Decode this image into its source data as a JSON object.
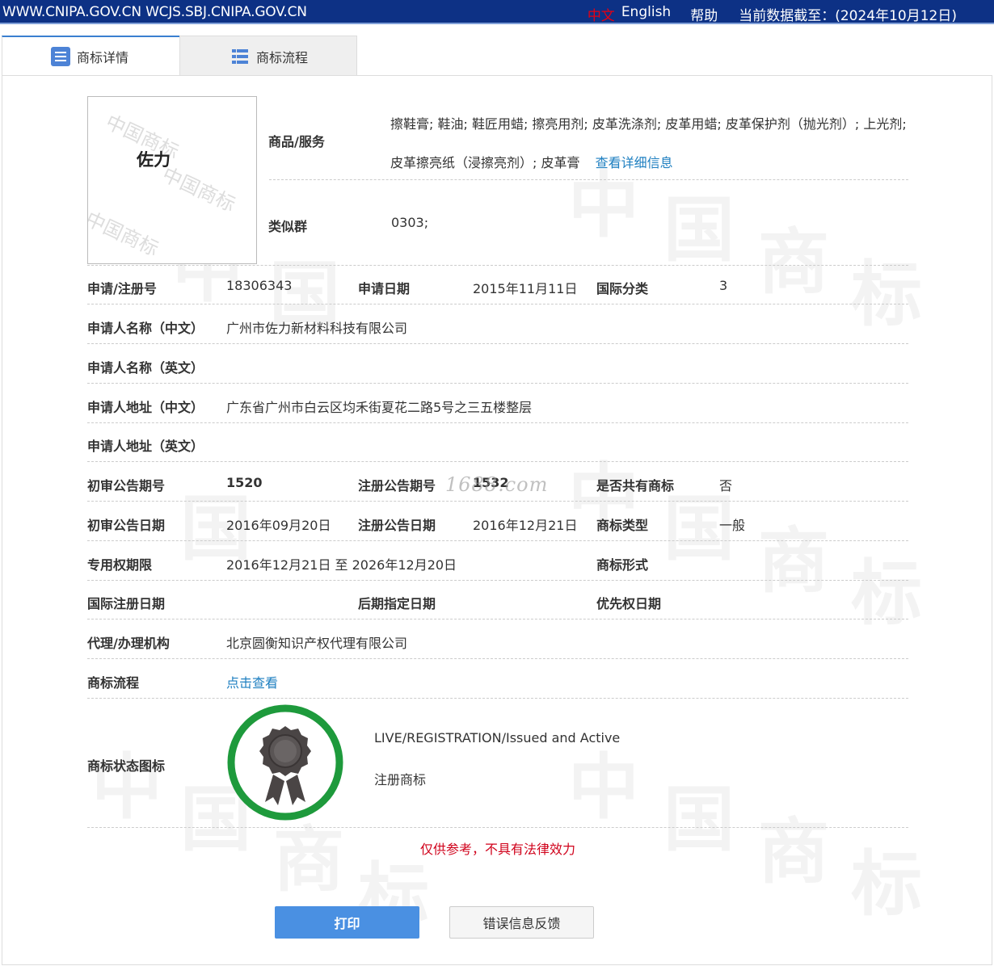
{
  "topbar": {
    "site": "WWW.CNIPA.GOV.CN WCJS.SBJ.CNIPA.GOV.CN",
    "lang_cn": "中文",
    "lang_en": "English",
    "help": "帮助",
    "data_date": "当前数据截至：(2024年10月12日)"
  },
  "tabs": [
    {
      "label": "商标详情",
      "icon": "list-icon"
    },
    {
      "label": "商标流程",
      "icon": "table-icon"
    }
  ],
  "mark": {
    "image_text": "佐力",
    "image_watermark": [
      "中国商标",
      "中国商标",
      "中国商标"
    ]
  },
  "goods": {
    "label": "商品/服务",
    "value": "擦鞋膏; 鞋油; 鞋匠用蜡; 擦亮用剂; 皮革洗涤剂; 皮革用蜡; 皮革保护剂（抛光剂）; 上光剂; 皮革擦亮纸（浸擦亮剂）; 皮革膏",
    "detail_link": "查看详细信息"
  },
  "similar_group": {
    "label": "类似群",
    "value": "0303;"
  },
  "fields": {
    "reg_no_label": "申请/注册号",
    "reg_no": "18306343",
    "apply_date_label": "申请日期",
    "apply_date": "2015年11月11日",
    "intl_class_label": "国际分类",
    "intl_class": "3",
    "applicant_cn_label": "申请人名称（中文）",
    "applicant_cn": "广州市佐力新材料科技有限公司",
    "applicant_en_label": "申请人名称（英文）",
    "applicant_en": "",
    "address_cn_label": "申请人地址（中文）",
    "address_cn": "广东省广州市白云区均禾街夏花二路5号之三五楼整层",
    "address_en_label": "申请人地址（英文）",
    "address_en": "",
    "prelim_issue_label": "初审公告期号",
    "prelim_issue": "1520",
    "reg_issue_label": "注册公告期号",
    "reg_issue": "1532",
    "shared_label": "是否共有商标",
    "shared": "否",
    "prelim_date_label": "初审公告日期",
    "prelim_date": "2016年09月20日",
    "reg_date_label": "注册公告日期",
    "reg_date": "2016年12月21日",
    "type_label": "商标类型",
    "type": "一般",
    "term_label": "专用权期限",
    "term": "2016年12月21日 至 2026年12月20日",
    "form_label": "商标形式",
    "form": "",
    "intl_reg_date_label": "国际注册日期",
    "intl_reg_date": "",
    "later_date_label": "后期指定日期",
    "later_date": "",
    "priority_date_label": "优先权日期",
    "priority_date": "",
    "agent_label": "代理/办理机构",
    "agent": "北京圆衡知识产权代理有限公司",
    "process_label": "商标流程",
    "process_link": "点击查看",
    "status_label": "商标状态图标",
    "status_en": "LIVE/REGISTRATION/Issued and Active",
    "status_cn": "注册商标"
  },
  "site_watermark": "1688.com",
  "disclaimer": "仅供参考，不具有法律效力",
  "buttons": {
    "print": "打印",
    "feedback": "错误信息反馈"
  },
  "colors": {
    "topbar": "#0d3185",
    "accent": "#4a90e2",
    "link": "#1e7fc0",
    "disclaimer": "#d0021b",
    "badge_ring": "#1e9a3c",
    "badge_medal": "#4a4545"
  }
}
